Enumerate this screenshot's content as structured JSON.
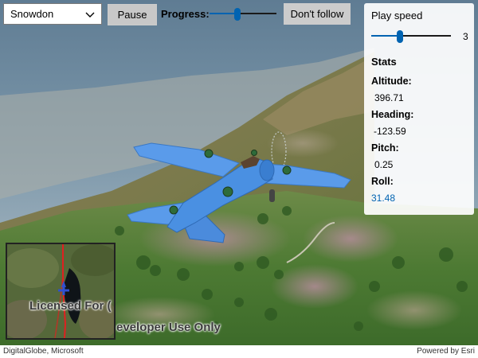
{
  "toolbar": {
    "route_selected": "Snowdon",
    "pause_label": "Pause",
    "progress_label": "Progress:",
    "progress_value": 0.42,
    "follow_label": "Don't follow"
  },
  "panel": {
    "play_speed_label": "Play speed",
    "play_speed_value": "3",
    "play_speed_fraction": 0.36,
    "stats_label": "Stats",
    "stats": [
      {
        "label": "Altitude:",
        "value": "396.71"
      },
      {
        "label": "Heading:",
        "value": "-123.59"
      },
      {
        "label": "Pitch:",
        "value": "0.25"
      },
      {
        "label": "Roll:",
        "value": "31.48"
      }
    ]
  },
  "watermark": {
    "inset_text": "Licensed For (",
    "main_text": "eveloper Use Only"
  },
  "attribution": {
    "left": "DigitalGlobe, Microsoft",
    "right": "Powered by Esri"
  },
  "colors": {
    "accent": "#0063b1",
    "plane": "#4a90e2",
    "route": "#e02020",
    "button_gray": "#cccccc"
  },
  "icons": {
    "route_dropdown": "chevron-down-icon",
    "plane": "airplane-model",
    "inset_marker": "plane-marker-icon"
  }
}
